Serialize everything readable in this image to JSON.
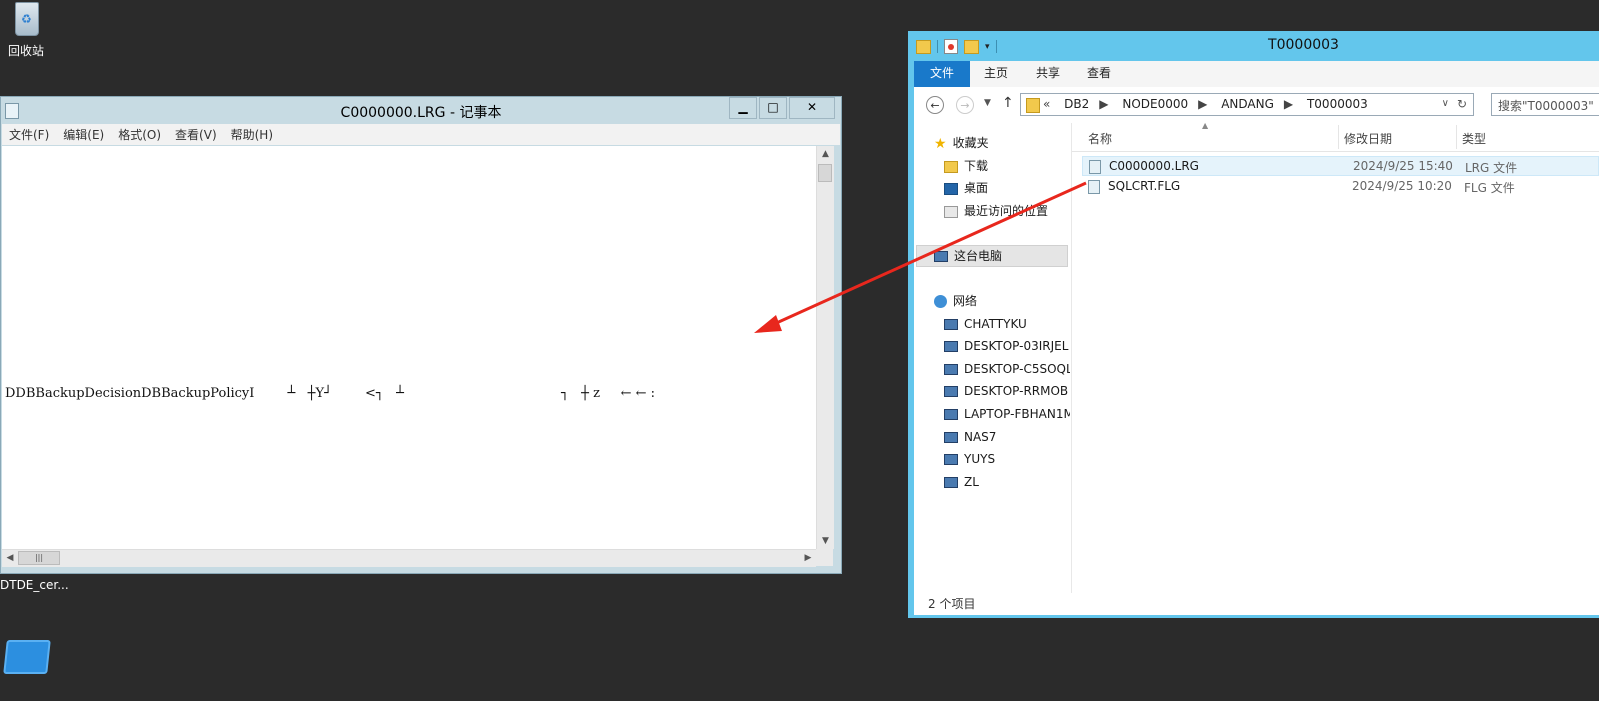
{
  "desktop": {
    "recycle_bin_label": "回收站",
    "dtde_label": "DTDE_cer..."
  },
  "notepad": {
    "title": "C0000000.LRG - 记事本",
    "menu": [
      "文件(F)",
      "编辑(E)",
      "格式(O)",
      "查看(V)",
      "帮助(H)"
    ],
    "content_line": "DDBBackupDecisionDBBackupPolicyI        ┴   ┼Y┘        <┐   ┴                                      ┐   ┼ z     ← ← :"
  },
  "explorer": {
    "title": "T0000003",
    "ribbon_tabs": [
      "文件",
      "主页",
      "共享",
      "查看"
    ],
    "breadcrumb": [
      "DB2",
      "NODE0000",
      "ANDANG",
      "T0000003"
    ],
    "search_placeholder": "搜索\"T0000003\"",
    "nav": {
      "favorites": "收藏夹",
      "downloads": "下载",
      "desktop": "桌面",
      "recent": "最近访问的位置",
      "this_pc": "这台电脑",
      "network": "网络",
      "computers": [
        "CHATTYKU",
        "DESKTOP-03IRJEL",
        "DESKTOP-C5SOQL",
        "DESKTOP-RRMOB",
        "LAPTOP-FBHAN1M",
        "NAS7",
        "YUYS",
        "ZL"
      ]
    },
    "columns": [
      "名称",
      "修改日期",
      "类型"
    ],
    "files": [
      {
        "name": "C0000000.LRG",
        "date": "2024/9/25 15:40",
        "type": "LRG 文件"
      },
      {
        "name": "SQLCRT.FLG",
        "date": "2024/9/25 10:20",
        "type": "FLG 文件"
      }
    ],
    "status": "2 个项目"
  },
  "colors": {
    "desktop_bg": "#2b2b2b",
    "explorer_frame": "#63c6ec",
    "notepad_frame": "#c7dbe3",
    "annotation_arrow": "#e8271d"
  }
}
